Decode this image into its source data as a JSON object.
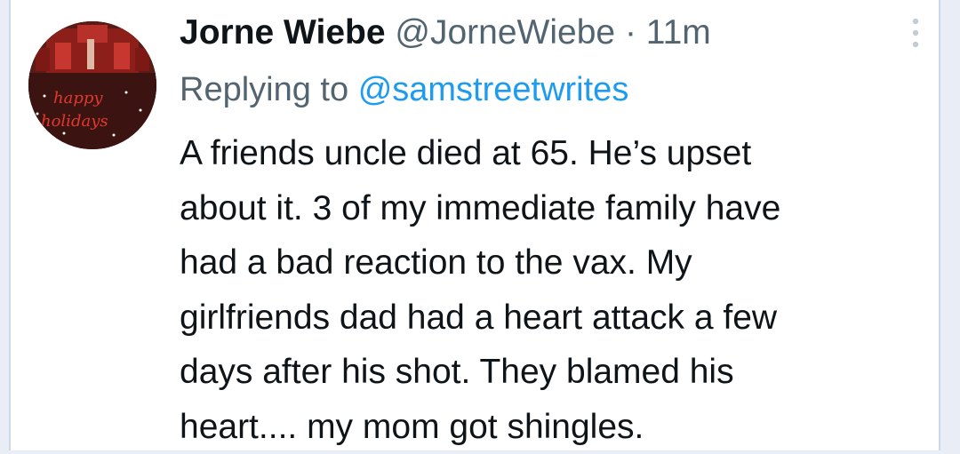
{
  "tweet": {
    "author_name": "Jorne Wiebe",
    "author_handle": "@JorneWiebe",
    "separator": "·",
    "timestamp": "11m",
    "reply_prefix": "Replying to",
    "reply_to": "@samstreetwrites",
    "text_lines": [
      "A friends uncle died at 65. He’s upset",
      "about it.  3 of my immediate family have",
      "had a bad reaction to the vax.  My",
      "girlfriends dad had a heart attack a few",
      "days after his shot. They blamed his",
      "heart.... my mom got shingles."
    ]
  },
  "icons": {
    "more": "vertical-dots-icon",
    "avatar": "avatar-happy-holidays-image"
  },
  "colors": {
    "text_primary": "#0f1419",
    "text_secondary": "#536471",
    "link": "#1d9bf0",
    "background": "#ffffff"
  }
}
